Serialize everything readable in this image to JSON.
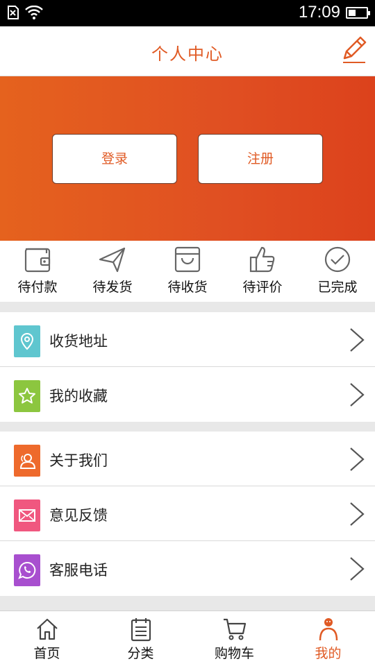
{
  "status_bar": {
    "time": "17:09",
    "battery_level": 0.4,
    "icons": [
      "sim-error-icon",
      "wifi-icon",
      "battery-icon"
    ]
  },
  "header": {
    "title": "个人中心",
    "edit_icon": "pencil-icon"
  },
  "colors": {
    "accent": "#e05a24",
    "banner_start": "#e5621e",
    "banner_end": "#dc421c"
  },
  "banner": {
    "login_label": "登录",
    "register_label": "注册"
  },
  "orders": [
    {
      "id": "pending-payment",
      "label": "待付款",
      "icon": "wallet-icon"
    },
    {
      "id": "pending-shipment",
      "label": "待发货",
      "icon": "paper-plane-icon"
    },
    {
      "id": "pending-receipt",
      "label": "待收货",
      "icon": "box-icon"
    },
    {
      "id": "pending-review",
      "label": "待评价",
      "icon": "thumbs-up-icon"
    },
    {
      "id": "completed",
      "label": "已完成",
      "icon": "check-circle-icon"
    }
  ],
  "list_group_1": [
    {
      "id": "address",
      "label": "收货地址",
      "icon": "location-pin-icon",
      "color": "#5fc6cf"
    },
    {
      "id": "favorites",
      "label": "我的收藏",
      "icon": "star-icon",
      "color": "#8cc63f"
    }
  ],
  "list_group_2": [
    {
      "id": "about",
      "label": "关于我们",
      "icon": "users-icon",
      "color": "#ee6a2c"
    },
    {
      "id": "feedback",
      "label": "意见反馈",
      "icon": "envelope-icon",
      "color": "#f0577f"
    },
    {
      "id": "service",
      "label": "客服电话",
      "icon": "phone-bubble-icon",
      "color": "#a84fcf"
    }
  ],
  "bottom_nav": [
    {
      "id": "home",
      "label": "首页",
      "icon": "home-icon"
    },
    {
      "id": "category",
      "label": "分类",
      "icon": "calendar-list-icon"
    },
    {
      "id": "cart",
      "label": "购物车",
      "icon": "cart-icon"
    },
    {
      "id": "mine",
      "label": "我的",
      "icon": "person-icon",
      "active": true
    }
  ]
}
